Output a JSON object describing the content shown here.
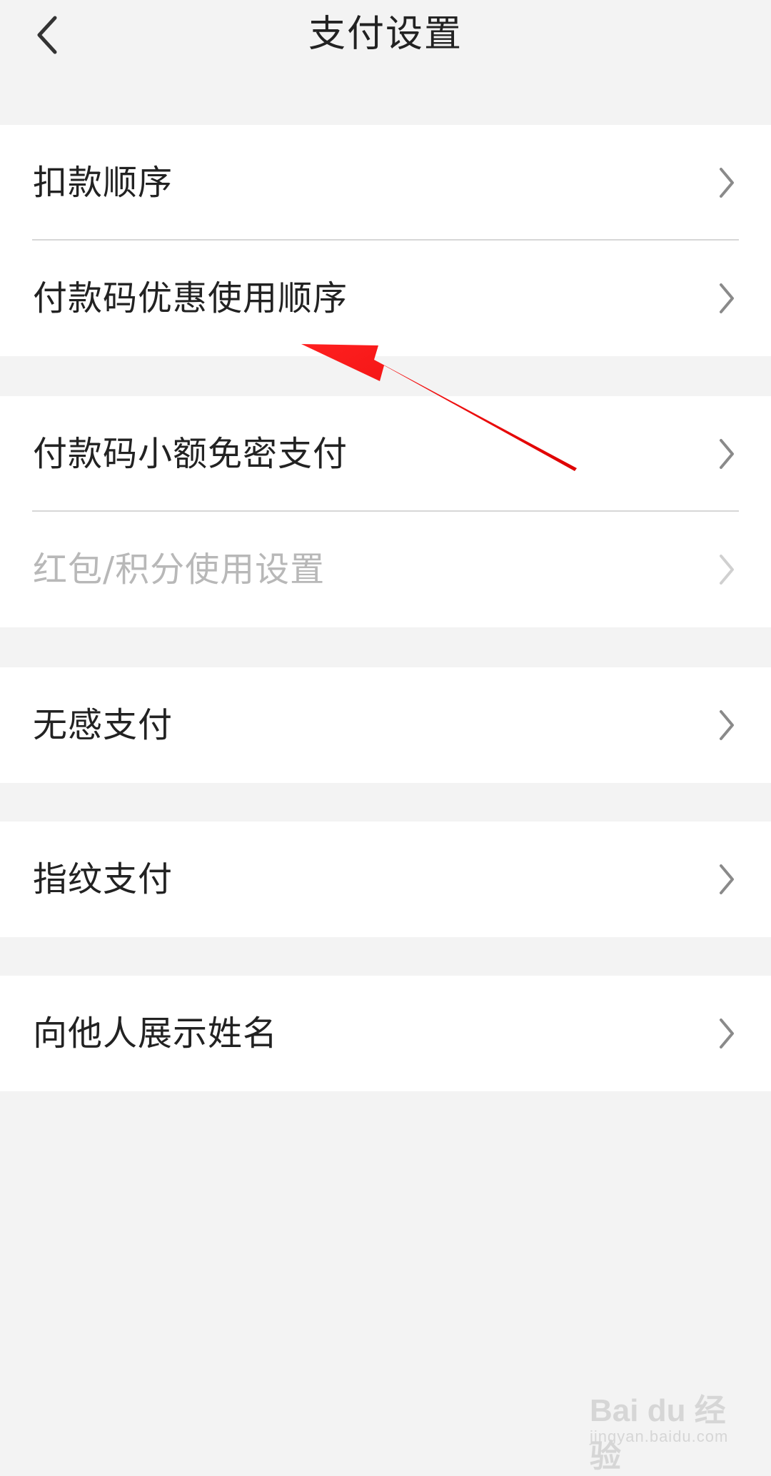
{
  "header": {
    "title": "支付设置",
    "back_icon": "chevron-left-icon"
  },
  "groups": [
    {
      "items": [
        {
          "label": "扣款顺序",
          "enabled": true
        },
        {
          "label": "付款码优惠使用顺序",
          "enabled": true
        }
      ]
    },
    {
      "items": [
        {
          "label": "付款码小额免密支付",
          "enabled": true
        },
        {
          "label": "红包/积分使用设置",
          "enabled": false
        }
      ]
    },
    {
      "items": [
        {
          "label": "无感支付",
          "enabled": true
        }
      ]
    },
    {
      "items": [
        {
          "label": "指纹支付",
          "enabled": true
        }
      ]
    },
    {
      "items": [
        {
          "label": "向他人展示姓名",
          "enabled": true
        }
      ]
    }
  ],
  "colors": {
    "background": "#f3f3f3",
    "card": "#ffffff",
    "text": "#222222",
    "disabled_text": "#b8b8b8",
    "annotation_arrow": "#ee1111"
  },
  "watermark": {
    "main": "Bai du 经验",
    "sub": "jingyan.baidu.com"
  }
}
